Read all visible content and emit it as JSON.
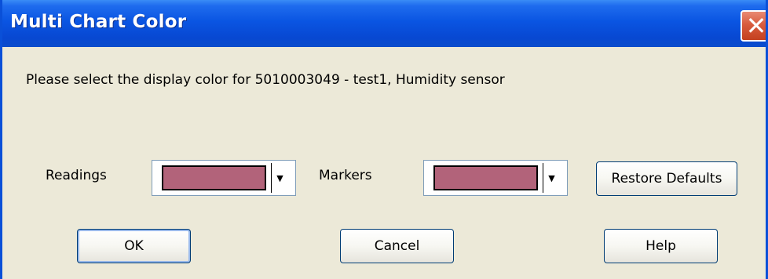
{
  "window": {
    "title": "Multi Chart Color",
    "close_icon": "close-icon"
  },
  "message": "Please select the display color for 5010003049 - test1, Humidity sensor",
  "readings": {
    "label": "Readings",
    "color": "#b2637a"
  },
  "markers": {
    "label": "Markers",
    "color": "#b2637a"
  },
  "buttons": {
    "restore_defaults": "Restore Defaults",
    "ok": "OK",
    "cancel": "Cancel",
    "help": "Help"
  },
  "colors": {
    "titlebar": "#0a55e2",
    "dialog_bg": "#ece9d8",
    "close_button": "#d85c3e"
  }
}
